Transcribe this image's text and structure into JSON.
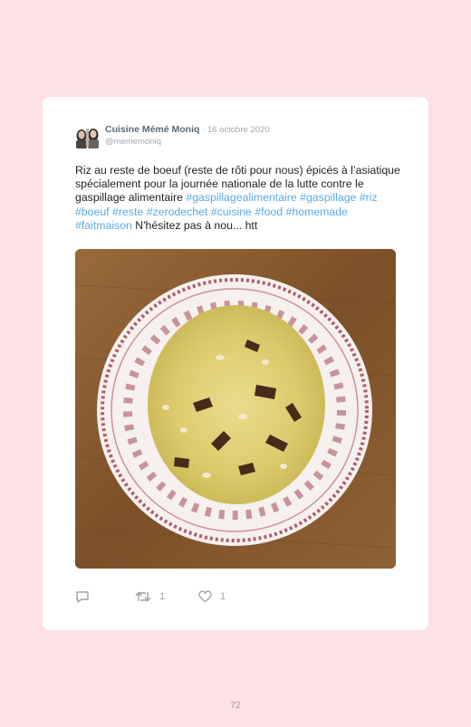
{
  "tweet": {
    "author_name": "Cuisine Mémé Moniq",
    "separator": " · ",
    "date": "16 octobre 2020",
    "handle": "@mememoniq",
    "text_segments": [
      {
        "text": "Riz au reste de boeuf (reste de rôti pour nous) épicés à l’asiatique spécialement pour la journée nationale de la lutte contre le gaspillage alimentaire ",
        "hashtag": false
      },
      {
        "text": "#gaspillagealimentaire",
        "hashtag": true
      },
      {
        "text": " ",
        "hashtag": false
      },
      {
        "text": "#gaspillage",
        "hashtag": true
      },
      {
        "text": " ",
        "hashtag": false
      },
      {
        "text": "#riz",
        "hashtag": true
      },
      {
        "text": " ",
        "hashtag": false
      },
      {
        "text": "#boeuf",
        "hashtag": true
      },
      {
        "text": " ",
        "hashtag": false
      },
      {
        "text": "#reste",
        "hashtag": true
      },
      {
        "text": " ",
        "hashtag": false
      },
      {
        "text": "#zerodechet",
        "hashtag": true
      },
      {
        "text": " ",
        "hashtag": false
      },
      {
        "text": "#cuisine",
        "hashtag": true
      },
      {
        "text": " ",
        "hashtag": false
      },
      {
        "text": "#food",
        "hashtag": true
      },
      {
        "text": " ",
        "hashtag": false
      },
      {
        "text": "#homemade",
        "hashtag": true
      },
      {
        "text": " ",
        "hashtag": false
      },
      {
        "text": "#faitmaison",
        "hashtag": true
      },
      {
        "text": " N'hésitez pas à nou... htt",
        "hashtag": false
      }
    ],
    "retweet_count": "1",
    "like_count": "1"
  },
  "icons": {
    "reply": "speech-bubble-icon",
    "retweet": "retweet-icon",
    "like": "heart-icon"
  },
  "colors": {
    "background": "#fde1e4",
    "hashtag": "#5aa9e6",
    "icon": "#9aa3ab"
  },
  "page_number": "72"
}
